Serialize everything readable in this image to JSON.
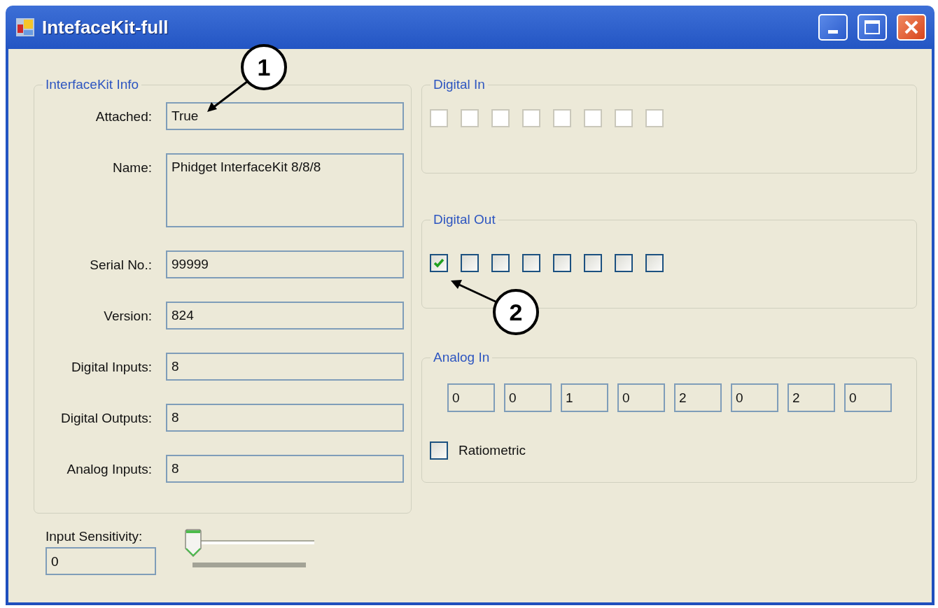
{
  "window": {
    "title": "IntefaceKit-full"
  },
  "info": {
    "title": "InterfaceKit Info",
    "fields": [
      {
        "label": "Attached:",
        "value": "True",
        "kind": "single"
      },
      {
        "label": "Name:",
        "value": "Phidget InterfaceKit 8/8/8",
        "kind": "multiline"
      },
      {
        "label": "Serial No.:",
        "value": "99999",
        "kind": "single"
      },
      {
        "label": "Version:",
        "value": "824",
        "kind": "single"
      },
      {
        "label": "Digital Inputs:",
        "value": "8",
        "kind": "single"
      },
      {
        "label": "Digital Outputs:",
        "value": "8",
        "kind": "single"
      },
      {
        "label": "Analog Inputs:",
        "value": "8",
        "kind": "single"
      }
    ]
  },
  "digital_in": {
    "title": "Digital In",
    "inputs": [
      {
        "checked": false,
        "disabled": true
      },
      {
        "checked": false,
        "disabled": true
      },
      {
        "checked": false,
        "disabled": true
      },
      {
        "checked": false,
        "disabled": true
      },
      {
        "checked": false,
        "disabled": true
      },
      {
        "checked": false,
        "disabled": true
      },
      {
        "checked": false,
        "disabled": true
      },
      {
        "checked": false,
        "disabled": true
      }
    ]
  },
  "digital_out": {
    "title": "Digital Out",
    "outputs": [
      {
        "checked": true,
        "disabled": false
      },
      {
        "checked": false,
        "disabled": false
      },
      {
        "checked": false,
        "disabled": false
      },
      {
        "checked": false,
        "disabled": false
      },
      {
        "checked": false,
        "disabled": false
      },
      {
        "checked": false,
        "disabled": false
      },
      {
        "checked": false,
        "disabled": false
      },
      {
        "checked": false,
        "disabled": false
      }
    ]
  },
  "analog_in": {
    "title": "Analog In",
    "values": [
      "0",
      "0",
      "1",
      "0",
      "2",
      "0",
      "2",
      "0"
    ],
    "ratiometric": {
      "label": "Ratiometric",
      "checked": false
    }
  },
  "sensitivity": {
    "label": "Input Sensitivity:",
    "value": "0",
    "level": 0
  },
  "callouts": [
    {
      "label": "1"
    },
    {
      "label": "2"
    }
  ]
}
